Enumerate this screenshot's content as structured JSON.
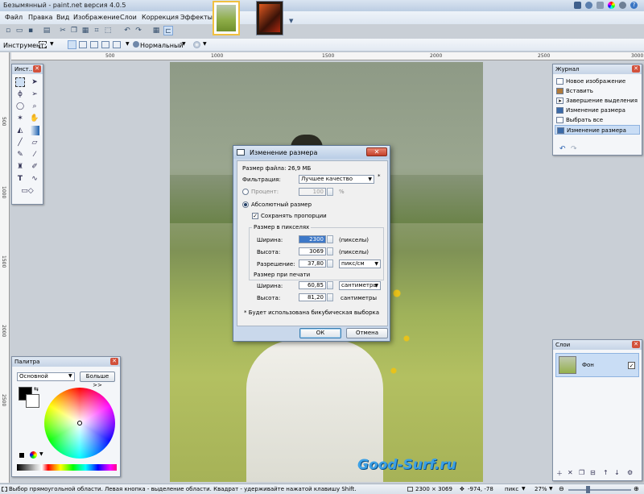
{
  "window": {
    "title": "Безымянный - paint.net версия 4.0.5"
  },
  "menu": {
    "items": [
      "Файл",
      "Правка",
      "Вид",
      "Изображение",
      "Слои",
      "Коррекция",
      "Эффекты"
    ]
  },
  "tool_options": {
    "tool_label": "Инструмент:",
    "blend_mode": "Нормальный"
  },
  "rulers": {
    "horizontal": [
      "500",
      "1000",
      "1500",
      "2000",
      "2500",
      "3000"
    ],
    "vertical": [
      "500",
      "1000",
      "1500",
      "2000",
      "2500"
    ]
  },
  "tools_panel": {
    "title": "Инст..."
  },
  "history_panel": {
    "title": "Журнал",
    "items": [
      "Новое изображение",
      "Вставить",
      "Завершение выделения",
      "Изменение размера",
      "Выбрать все",
      "Изменение размера"
    ],
    "selected_index": 5
  },
  "layers_panel": {
    "title": "Слои",
    "layer_name": "Фон",
    "visible": true
  },
  "palette_panel": {
    "title": "Палитра",
    "mode": "Основной",
    "more_button": "Больше >>"
  },
  "dialog": {
    "title": "Изменение размера",
    "file_size": "Размер файла: 26,9 МБ",
    "filter_label": "Фильтрация:",
    "filter_value": "Лучшее качество",
    "asterisk": "*",
    "percent_label": "Процент:",
    "percent_value": "100",
    "percent_unit": "%",
    "absolute_label": "Абсолютный размер",
    "keep_aspect_label": "Сохранять пропорции",
    "pixel_group": "Размер в пикселях",
    "width_label": "Ширина:",
    "width_px": "2300",
    "width_px_unit": "(пикселы)",
    "height_label": "Высота:",
    "height_px": "3069",
    "height_px_unit": "(пикселы)",
    "resolution_label": "Разрешение:",
    "resolution_value": "37,80",
    "resolution_unit": "пикс/см",
    "print_group": "Размер при печати",
    "print_width_label": "Ширина:",
    "print_width": "60,85",
    "print_width_unit": "сантиметры",
    "print_height_label": "Высота:",
    "print_height": "81,20",
    "print_height_unit": "сантиметры",
    "footnote": "* Будет использована бикубическая выборка",
    "ok": "ОК",
    "cancel": "Отмена"
  },
  "canvas": {
    "watermark": "Good-Surf.ru"
  },
  "statusbar": {
    "hint": "Выбор прямоугольной области. Левая кнопка - выделение области. Квадрат - удерживайте нажатой клавишу Shift.",
    "image_size": "2300 × 3069",
    "coords": "-974, -78",
    "units": "пикс",
    "zoom": "27%"
  }
}
